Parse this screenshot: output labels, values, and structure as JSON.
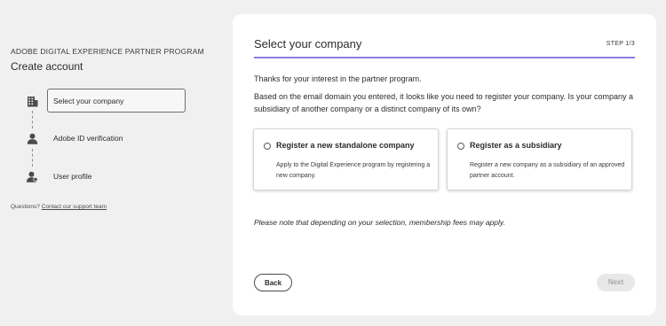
{
  "sidebar": {
    "program_title": "ADOBE DIGITAL EXPERIENCE PARTNER PROGRAM",
    "heading": "Create account",
    "steps": [
      {
        "label": "Select your company",
        "icon": "building-icon",
        "active": true
      },
      {
        "label": "Adobe ID verification",
        "icon": "user-icon",
        "active": false
      },
      {
        "label": "User profile",
        "icon": "user-profile-icon",
        "active": false
      }
    ],
    "questions_text": "Questions?",
    "support_link": "Contact our support team"
  },
  "main": {
    "title": "Select your company",
    "step_indicator": "STEP 1/3",
    "accent_color": "#8a7fe0",
    "intro": "Thanks for your interest in the partner program.",
    "description": "Based on the email domain you entered, it looks like you need to register your company. Is your company a subsidiary of another company or a distinct company of its own?",
    "options": [
      {
        "title": "Register a new standalone company",
        "description": "Apply to the Digital Experience program by registering a new company.",
        "selected": false
      },
      {
        "title": "Register as a subsidiary",
        "description": "Register a new company as a subsidiary of an approved partner account.",
        "selected": false
      }
    ],
    "note": "Please note that depending on your selection, membership fees may apply.",
    "back_label": "Back",
    "next_label": "Next"
  }
}
